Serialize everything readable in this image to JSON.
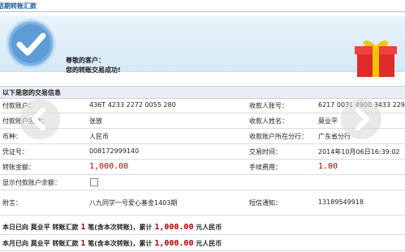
{
  "title": "活期转账汇款",
  "banner": {
    "line1": "尊敬的客户：",
    "line2": "您的转账交易成功!"
  },
  "section_title": "以下是您的交易信息",
  "rows": [
    {
      "l1": "付款账户：",
      "v1": "436T 4233 2272 0055 280",
      "l2": "收款人账号：",
      "v2": "6217 0031 4900 3433 229"
    },
    {
      "l1": "付款账户名称：",
      "v1": "张放",
      "l2": "收款人姓名：",
      "v2": "莫业平"
    },
    {
      "l1": "币种：",
      "v1": "人民币",
      "l2": "收款账户所在分行：",
      "v2": "广东省分行"
    },
    {
      "l1": "凭证号：",
      "v1": "008172999140",
      "l2": "交易时间：",
      "v2": "2014年10月06日16:39:02"
    },
    {
      "l1": "转账金额：",
      "v1": "1,000.00",
      "l2": "手续费用：",
      "v2": "1.00"
    },
    {
      "l1": "显示付款账户余额：",
      "v1": "",
      "l2": "",
      "v2": ""
    },
    {
      "l1": "附言：",
      "v1": "八九同学一号爱心基金1403期",
      "l2": "短信通知：",
      "v2": "13189549918"
    }
  ],
  "summary_today": {
    "prefix": "本日已向  莫业平  转账汇款",
    "count": "1",
    "mid": "笔(含本次转账)，累计",
    "amount": "1,000.00",
    "suffix": "元人民币"
  },
  "summary_month": {
    "prefix": "本月已向  莫业平  转账汇款",
    "count": "1",
    "mid": "笔(含本次转账)，累计",
    "amount": "1,000.00",
    "suffix": "元人民币"
  },
  "icons": {
    "success": "check-circle-icon",
    "gift": "gift-box-icon",
    "prev": "chevron-left-icon",
    "next": "chevron-right-icon"
  },
  "colors": {
    "accent": "#1a5c9c",
    "amount_red": "#b00000",
    "banner_bg": "#dcedf8"
  }
}
